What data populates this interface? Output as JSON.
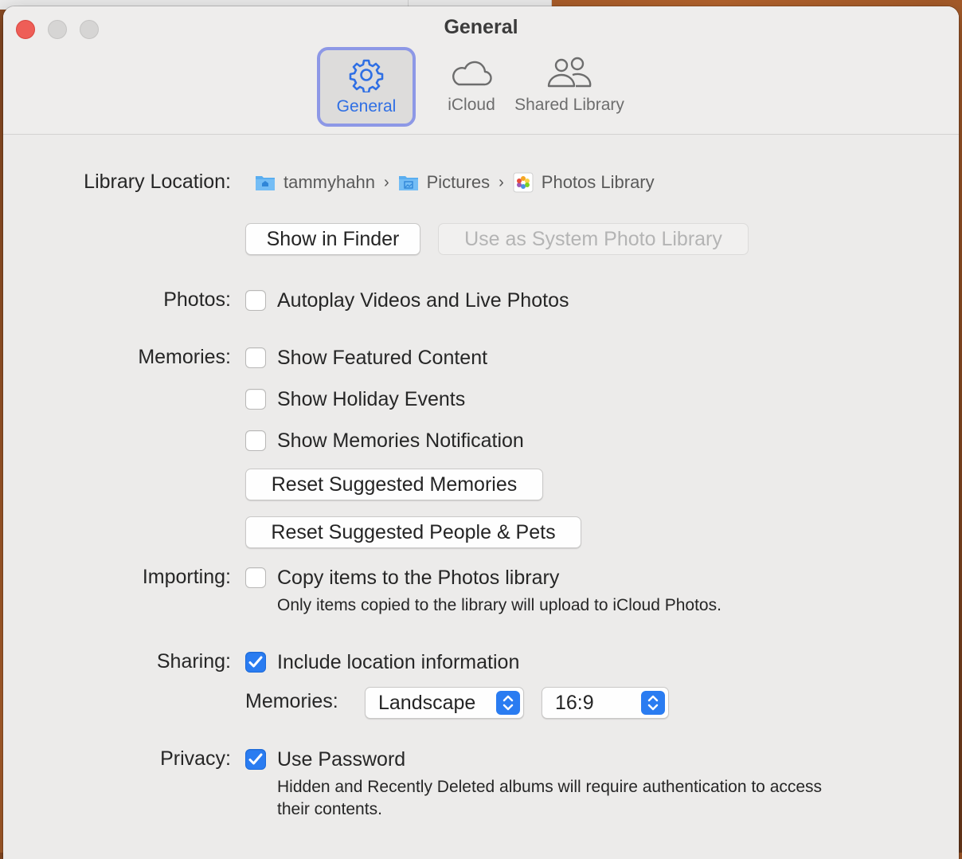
{
  "window": {
    "title": "General"
  },
  "tabs": [
    {
      "label": "General",
      "icon": "gear-icon",
      "selected": true
    },
    {
      "label": "iCloud",
      "icon": "cloud-icon",
      "selected": false
    },
    {
      "label": "Shared Library",
      "icon": "people-icon",
      "selected": false
    }
  ],
  "library": {
    "label": "Library Location:",
    "path": [
      "tammyhahn",
      "Pictures",
      "Photos Library"
    ],
    "path_icons": [
      "home-folder-icon",
      "pictures-folder-icon",
      "photos-library-icon"
    ],
    "show_in_finder": "Show in Finder",
    "use_as_system": "Use as System Photo Library"
  },
  "photos": {
    "label": "Photos:",
    "autoplay": {
      "text": "Autoplay Videos and Live Photos",
      "checked": false
    }
  },
  "memories": {
    "label": "Memories:",
    "featured": {
      "text": "Show Featured Content",
      "checked": false
    },
    "holiday": {
      "text": "Show Holiday Events",
      "checked": false
    },
    "notification": {
      "text": "Show Memories Notification",
      "checked": false
    },
    "reset_memories": "Reset Suggested Memories",
    "reset_people": "Reset Suggested People & Pets"
  },
  "importing": {
    "label": "Importing:",
    "copy": {
      "text": "Copy items to the Photos library",
      "checked": false
    },
    "note": "Only items copied to the library will upload to iCloud Photos."
  },
  "sharing": {
    "label": "Sharing:",
    "location": {
      "text": "Include location information",
      "checked": true
    },
    "memories_label": "Memories:",
    "orientation": "Landscape",
    "aspect": "16:9"
  },
  "privacy": {
    "label": "Privacy:",
    "password": {
      "text": "Use Password",
      "checked": true
    },
    "note": "Hidden and Recently Deleted albums will require authentication to access their contents."
  },
  "colors": {
    "accent": "#2a7cf1",
    "selected_tab_border": "#8d98e6",
    "close": "#ee5e57"
  }
}
